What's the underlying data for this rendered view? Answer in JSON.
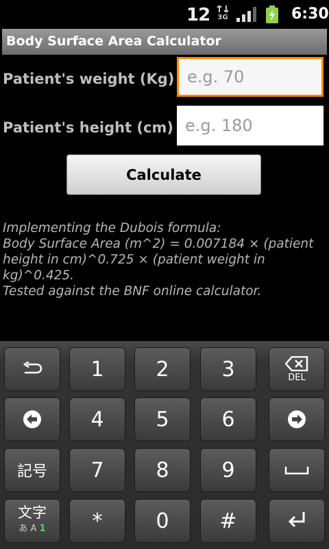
{
  "status_bar": {
    "notification_count": "12",
    "network_type": "3G",
    "time": "6:30"
  },
  "title": "Body Surface Area Calculator",
  "form": {
    "weight_label": "Patient's weight (Kg)",
    "weight_placeholder": "e.g. 70",
    "height_label": "Patient's height (cm)",
    "height_placeholder": "e.g. 180",
    "calculate_label": "Calculate"
  },
  "description": [
    "Implementing the Dubois formula:",
    "Body Surface Area (m^2) = 0.007184 × (patient height in cm)^0.725 × (patient weight in kg)^0.425.",
    "Tested against the BNF online calculator."
  ],
  "keyboard": {
    "digits": [
      "1",
      "2",
      "3",
      "4",
      "5",
      "6",
      "7",
      "8",
      "9",
      "*",
      "0",
      "#"
    ],
    "del_label": "DEL",
    "symbols_label": "記号",
    "mode_label": "文字",
    "mode_sub_kana": "あ A",
    "mode_sub_num": "1",
    "icons": {
      "undo": "undo-icon",
      "left": "arrow-left-icon",
      "right": "arrow-right-icon",
      "space": "space-icon",
      "enter": "enter-icon",
      "del": "backspace-icon"
    }
  },
  "colors": {
    "focus_border": "#ff8a00",
    "title_bar": "#7f7f7f"
  }
}
